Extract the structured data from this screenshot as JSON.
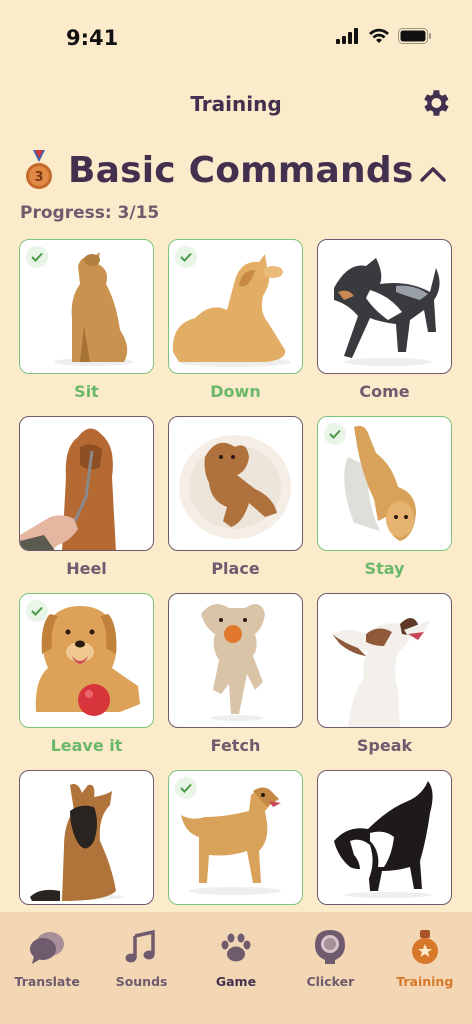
{
  "status": {
    "time": "9:41"
  },
  "header": {
    "title": "Training"
  },
  "section": {
    "title": "Basic Commands",
    "medal_number": "3",
    "progress": "Progress: 3/15"
  },
  "commands": [
    {
      "label": "Sit",
      "completed": true
    },
    {
      "label": "Down",
      "completed": true
    },
    {
      "label": "Come",
      "completed": false
    },
    {
      "label": "Heel",
      "completed": false
    },
    {
      "label": "Place",
      "completed": false
    },
    {
      "label": "Stay",
      "completed": true
    },
    {
      "label": "Leave it",
      "completed": true
    },
    {
      "label": "Fetch",
      "completed": false
    },
    {
      "label": "Speak",
      "completed": false
    },
    {
      "label": "",
      "completed": false
    },
    {
      "label": "",
      "completed": true
    },
    {
      "label": "",
      "completed": false
    }
  ],
  "tabs": [
    {
      "label": "Translate",
      "icon": "chat-bubbles-icon"
    },
    {
      "label": "Sounds",
      "icon": "music-notes-icon"
    },
    {
      "label": "Game",
      "icon": "paw-icon"
    },
    {
      "label": "Clicker",
      "icon": "clicker-icon"
    },
    {
      "label": "Training",
      "icon": "whistle-icon"
    }
  ],
  "colors": {
    "background": "#FCEBCB",
    "accent": "#43304F",
    "completed": "#7CC47A",
    "active_tab": "#D7782A",
    "tabbar": "#F3D6B4"
  }
}
